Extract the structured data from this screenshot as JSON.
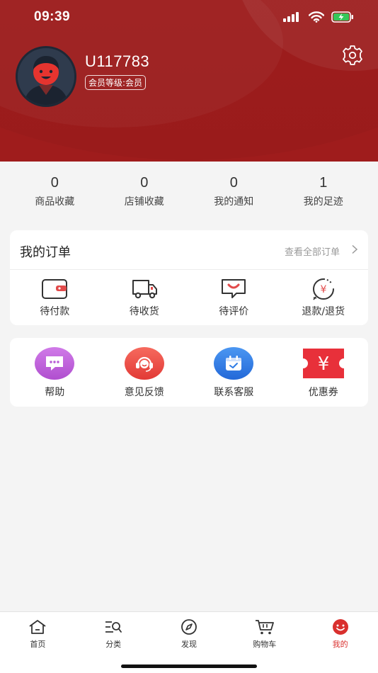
{
  "status_bar": {
    "time": "09:39"
  },
  "profile": {
    "username": "U117783",
    "level_badge": "会员等级:会员",
    "settings_icon": "gear-icon"
  },
  "stats": [
    {
      "value": "0",
      "label": "商品收藏"
    },
    {
      "value": "0",
      "label": "店铺收藏"
    },
    {
      "value": "0",
      "label": "我的通知"
    },
    {
      "value": "1",
      "label": "我的足迹"
    }
  ],
  "orders": {
    "title": "我的订单",
    "view_all": "查看全部订单",
    "items": [
      {
        "label": "待付款",
        "icon": "wallet-icon"
      },
      {
        "label": "待收货",
        "icon": "truck-icon"
      },
      {
        "label": "待评价",
        "icon": "comment-icon"
      },
      {
        "label": "退款/退货",
        "icon": "refund-icon"
      }
    ]
  },
  "services": [
    {
      "label": "帮助",
      "icon": "chat-bubble-icon",
      "color": "#b75bd6"
    },
    {
      "label": "意见反馈",
      "icon": "headset-icon",
      "color": "#ef4b45"
    },
    {
      "label": "联系客服",
      "icon": "calendar-icon",
      "color": "#2c7be6"
    },
    {
      "label": "优惠券",
      "icon": "coupon-icon",
      "color": "#e8303a"
    }
  ],
  "tabbar": {
    "active_color": "#d9302e",
    "tabs": [
      {
        "label": "首页",
        "icon": "home-icon",
        "active": false
      },
      {
        "label": "分类",
        "icon": "category-search-icon",
        "active": false
      },
      {
        "label": "发现",
        "icon": "compass-icon",
        "active": false
      },
      {
        "label": "购物车",
        "icon": "cart-icon",
        "active": false
      },
      {
        "label": "我的",
        "icon": "smiley-icon",
        "active": true
      }
    ]
  },
  "colors": {
    "header_red": "#9f1c1c",
    "page_bg": "#f4f4f4"
  }
}
